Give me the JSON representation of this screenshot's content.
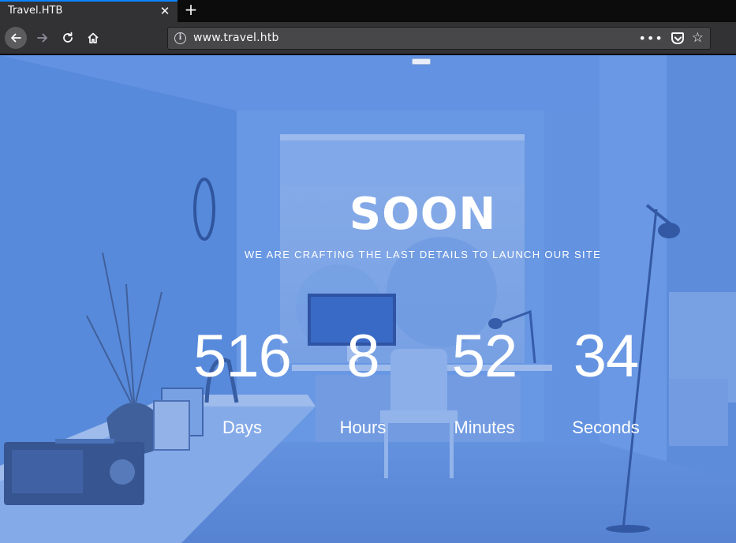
{
  "browser": {
    "tab_title": "Travel.HTB",
    "tab_close_glyph": "✕",
    "new_tab_glyph": "+",
    "url": "www.travel.htb",
    "url_more_glyph": "•••",
    "icons": [
      "back-arrow-icon",
      "forward-arrow-icon",
      "reload-icon",
      "home-icon",
      "info-icon",
      "page-actions-icon",
      "pocket-icon",
      "bookmark-star-icon"
    ]
  },
  "page": {
    "title": "SOON",
    "subtitle": "WE ARE CRAFTING THE LAST DETAILS TO LAUNCH OUR SITE",
    "countdown": [
      {
        "value": "516",
        "label": "Days"
      },
      {
        "value": "8",
        "label": "Hours"
      },
      {
        "value": "52",
        "label": "Minutes"
      },
      {
        "value": "34",
        "label": "Seconds"
      }
    ],
    "colors": {
      "overlay": "#4e82de",
      "text": "#ffffff"
    }
  }
}
